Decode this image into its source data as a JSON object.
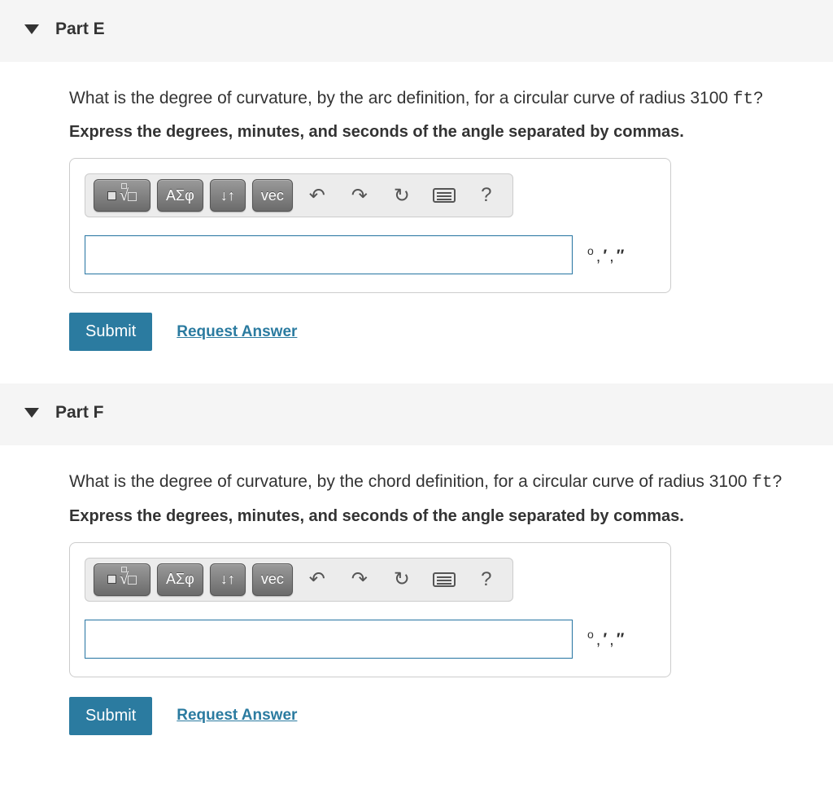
{
  "parts": [
    {
      "id": "E",
      "title": "Part E",
      "question_prefix": "What is the degree of curvature, by the arc definition, for a circular curve of radius 3100 ",
      "unit": "ft",
      "question_suffix": "?",
      "instruction": "Express the degrees, minutes, and seconds of the angle separated by commas.",
      "units_label": "° , ′ , ″",
      "submit_label": "Submit",
      "request_label": "Request Answer",
      "answer_value": ""
    },
    {
      "id": "F",
      "title": "Part F",
      "question_prefix": "What is the degree of curvature, by the chord definition, for a circular curve of radius 3100 ",
      "unit": "ft",
      "question_suffix": "?",
      "instruction": "Express the degrees, minutes, and seconds of the angle separated by commas.",
      "units_label": "° , ′ , ″",
      "submit_label": "Submit",
      "request_label": "Request Answer",
      "answer_value": ""
    }
  ],
  "toolbar": {
    "greek_label": "ΑΣφ",
    "subsup_label": "↓↑",
    "vec_label": "vec",
    "undo_label": "↶",
    "redo_label": "↷",
    "reset_label": "↻",
    "help_label": "?"
  }
}
